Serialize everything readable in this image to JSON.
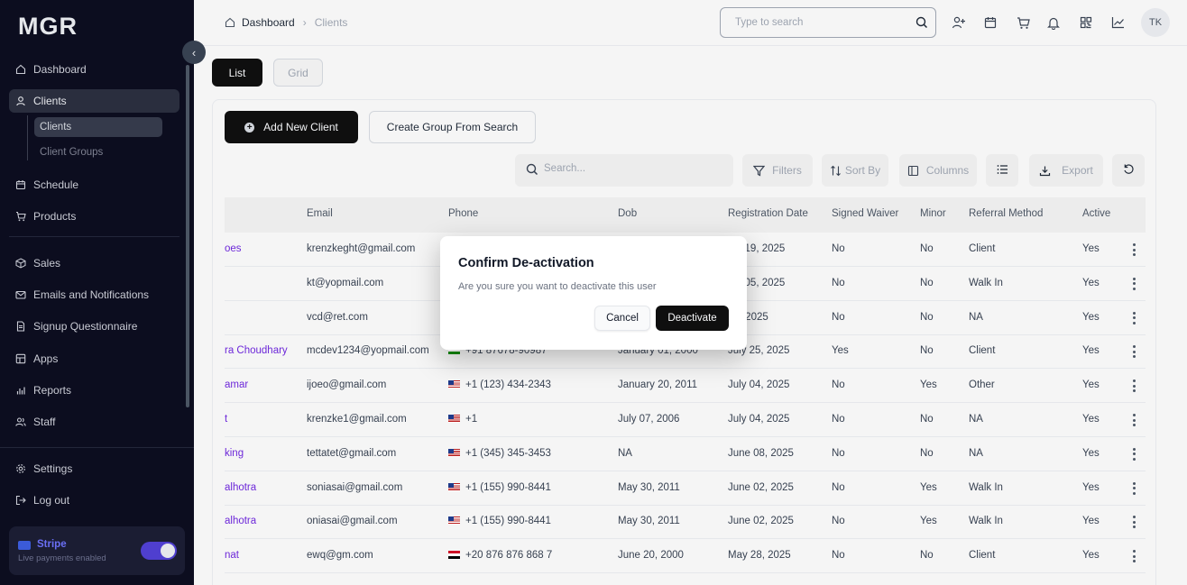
{
  "app": {
    "logo": "MGR"
  },
  "sidebar": {
    "items": [
      {
        "label": "Dashboard",
        "icon": "home-icon"
      },
      {
        "label": "Clients",
        "icon": "user-icon",
        "active": true
      },
      {
        "label": "Schedule",
        "icon": "calendar-icon"
      },
      {
        "label": "Products",
        "icon": "cart-icon"
      },
      {
        "label": "Sales",
        "icon": "box-icon"
      },
      {
        "label": "Emails and Notifications",
        "icon": "mail-icon"
      },
      {
        "label": "Signup Questionnaire",
        "icon": "document-icon"
      },
      {
        "label": "Apps",
        "icon": "apps-icon"
      },
      {
        "label": "Reports",
        "icon": "bar-chart-icon"
      },
      {
        "label": "Staff",
        "icon": "users-icon"
      },
      {
        "label": "Settings",
        "icon": "gear-icon"
      },
      {
        "label": "Log out",
        "icon": "logout-icon"
      }
    ],
    "sub_items": [
      {
        "label": "Clients",
        "active": true
      },
      {
        "label": "Client Groups"
      }
    ],
    "stripe": {
      "title": "Stripe",
      "subtitle": "Live payments enabled",
      "enabled": true
    }
  },
  "header": {
    "breadcrumb": {
      "current": "Dashboard",
      "link": "Clients"
    },
    "search_placeholder": "Type to search",
    "avatar_initials": "TK"
  },
  "view_tabs": {
    "list": "List",
    "grid": "Grid",
    "active": "List"
  },
  "toolbar": {
    "add_client": "Add New Client",
    "create_group": "Create Group From Search",
    "search_placeholder": "Search...",
    "filters": "Filters",
    "sort_by": "Sort By",
    "columns": "Columns",
    "export": "Export"
  },
  "table": {
    "columns": [
      "Email",
      "Phone",
      "Dob",
      "Registration Date",
      "Signed Waiver",
      "Minor",
      "Referral Method",
      "Active"
    ],
    "rows": [
      {
        "name": "oes",
        "email": "krenzkeght@gmail.com",
        "flag": "",
        "phone": "",
        "dob": "",
        "reg": "ust 19, 2025",
        "waiver": "No",
        "minor": "No",
        "referral": "Client",
        "active": "Yes"
      },
      {
        "name": "",
        "email": "kt@yopmail.com",
        "flag": "",
        "phone": "",
        "dob": "",
        "reg": "ust 05, 2025",
        "waiver": "No",
        "minor": "No",
        "referral": "Walk In",
        "active": "Yes"
      },
      {
        "name": "",
        "email": "vcd@ret.com",
        "flag": "",
        "phone": "",
        "dob": "",
        "reg": "29, 2025",
        "waiver": "No",
        "minor": "No",
        "referral": "NA",
        "active": "Yes"
      },
      {
        "name": "ra Choudhary",
        "email": "mcdev1234@yopmail.com",
        "flag": "in",
        "phone": "+91 87678-90987",
        "dob": "January 01, 2000",
        "reg": "July 25, 2025",
        "waiver": "Yes",
        "minor": "No",
        "referral": "Client",
        "active": "Yes"
      },
      {
        "name": "amar",
        "email": "ijoeo@gmail.com",
        "flag": "us",
        "phone": "+1 (123) 434-2343",
        "dob": "January 20, 2011",
        "reg": "July 04, 2025",
        "waiver": "No",
        "minor": "Yes",
        "referral": "Other",
        "active": "Yes"
      },
      {
        "name": "t",
        "email": "krenzke1@gmail.com",
        "flag": "us",
        "phone": "+1",
        "dob": "July 07, 2006",
        "reg": "July 04, 2025",
        "waiver": "No",
        "minor": "No",
        "referral": "NA",
        "active": "Yes"
      },
      {
        "name": "king",
        "email": "tettatet@gmail.com",
        "flag": "us",
        "phone": "+1 (345) 345-3453",
        "dob": "NA",
        "reg": "June 08, 2025",
        "waiver": "No",
        "minor": "No",
        "referral": "NA",
        "active": "Yes"
      },
      {
        "name": "alhotra",
        "email": "soniasai@gmail.com",
        "flag": "us",
        "phone": "+1 (155) 990-8441",
        "dob": "May 30, 2011",
        "reg": "June 02, 2025",
        "waiver": "No",
        "minor": "Yes",
        "referral": "Walk In",
        "active": "Yes"
      },
      {
        "name": "alhotra",
        "email": "oniasai@gmail.com",
        "flag": "us",
        "phone": "+1 (155) 990-8441",
        "dob": "May 30, 2011",
        "reg": "June 02, 2025",
        "waiver": "No",
        "minor": "Yes",
        "referral": "Walk In",
        "active": "Yes"
      },
      {
        "name": "nat",
        "email": "ewq@gm.com",
        "flag": "eg",
        "phone": "+20 876 876 868 7",
        "dob": "June 20, 2000",
        "reg": "May 28, 2025",
        "waiver": "No",
        "minor": "No",
        "referral": "Client",
        "active": "Yes"
      }
    ]
  },
  "modal": {
    "title": "Confirm De-activation",
    "message": "Are you sure you want to deactivate this user",
    "cancel": "Cancel",
    "confirm": "Deactivate"
  },
  "colors": {
    "sidebar_bg": "#0c0d1f",
    "accent": "#6d28d9",
    "primary_button": "#0f0f0f",
    "stripe": "#6a6ff4"
  }
}
